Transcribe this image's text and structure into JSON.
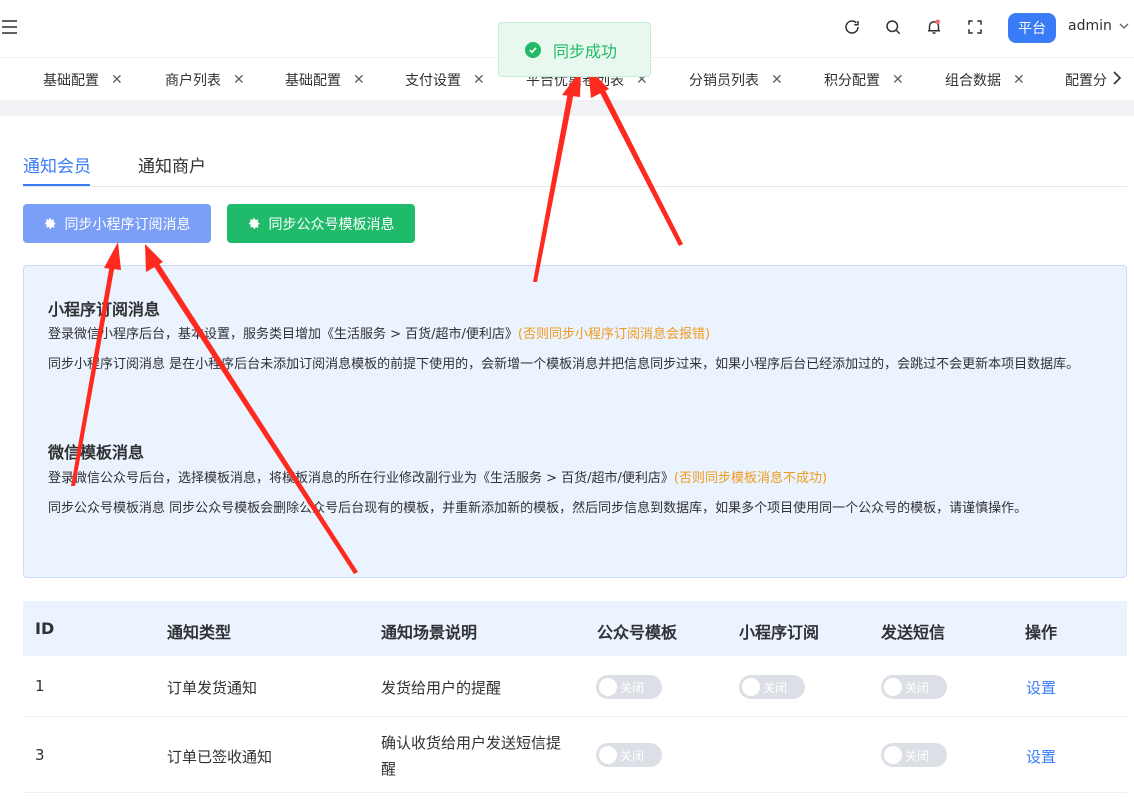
{
  "header": {
    "platform_label": "平台",
    "user_name": "admin",
    "icons": [
      "menu-fold-icon",
      "refresh-icon",
      "search-icon",
      "bell-icon",
      "fullscreen-icon",
      "chevron-down-icon"
    ]
  },
  "tags": [
    {
      "label": "基础配置"
    },
    {
      "label": "商户列表"
    },
    {
      "label": "基础配置"
    },
    {
      "label": "支付设置"
    },
    {
      "label": "平台优惠卷列表"
    },
    {
      "label": "分销员列表"
    },
    {
      "label": "积分配置"
    },
    {
      "label": "组合数据"
    },
    {
      "label": "配置分"
    }
  ],
  "toast": {
    "message": "同步成功",
    "status_color": "#21ba68"
  },
  "tabs": [
    {
      "label": "通知会员",
      "active": true
    },
    {
      "label": "通知商户",
      "active": false
    }
  ],
  "buttons": {
    "sync_miniprogram": "同步小程序订阅消息",
    "sync_official": "同步公众号模板消息"
  },
  "info": {
    "mini_title": "小程序订阅消息",
    "mini_line1": "登录微信小程序后台，基本设置，服务类目增加《生活服务 > 百货/超市/便利店》",
    "mini_line1_warn": "(否则同步小程序订阅消息会报错)",
    "mini_line2": "同步小程序订阅消息 是在小程序后台未添加订阅消息模板的前提下使用的，会新增一个模板消息并把信息同步过来，如果小程序后台已经添加过的，会跳过不会更新本项目数据库。",
    "wx_title": "微信模板消息",
    "wx_line1": "登录微信公众号后台，选择模板消息，将模板消息的所在行业修改副行业为《生活服务 > 百货/超市/便利店》",
    "wx_line1_warn": "(否则同步模板消息不成功)",
    "wx_line2": "同步公众号模板消息 同步公众号模板会删除公众号后台现有的模板，并重新添加新的模板，然后同步信息到数据库，如果多个项目使用同一个公众号的模板，请谨慎操作。"
  },
  "table": {
    "headers": [
      "ID",
      "通知类型",
      "通知场景说明",
      "公众号模板",
      "小程序订阅",
      "发送短信",
      "操作"
    ],
    "rows": [
      {
        "id": "1",
        "type": "订单发货通知",
        "desc_line1": "发货给用户的提醒",
        "desc_line2": "",
        "official": "关闭",
        "mini": "关闭",
        "sms": "关闭",
        "action": "设置"
      },
      {
        "id": "3",
        "type": "订单已签收通知",
        "desc_line1": "确认收货给用户发送短信提",
        "desc_line2": "醒",
        "official": "关闭",
        "mini": "",
        "sms": "关闭",
        "action": "设置"
      }
    ]
  },
  "colors": {
    "accent": "#3a7bf7",
    "success": "#21ba68",
    "warning": "#f09a1e",
    "annotation": "#ff2a1f"
  }
}
